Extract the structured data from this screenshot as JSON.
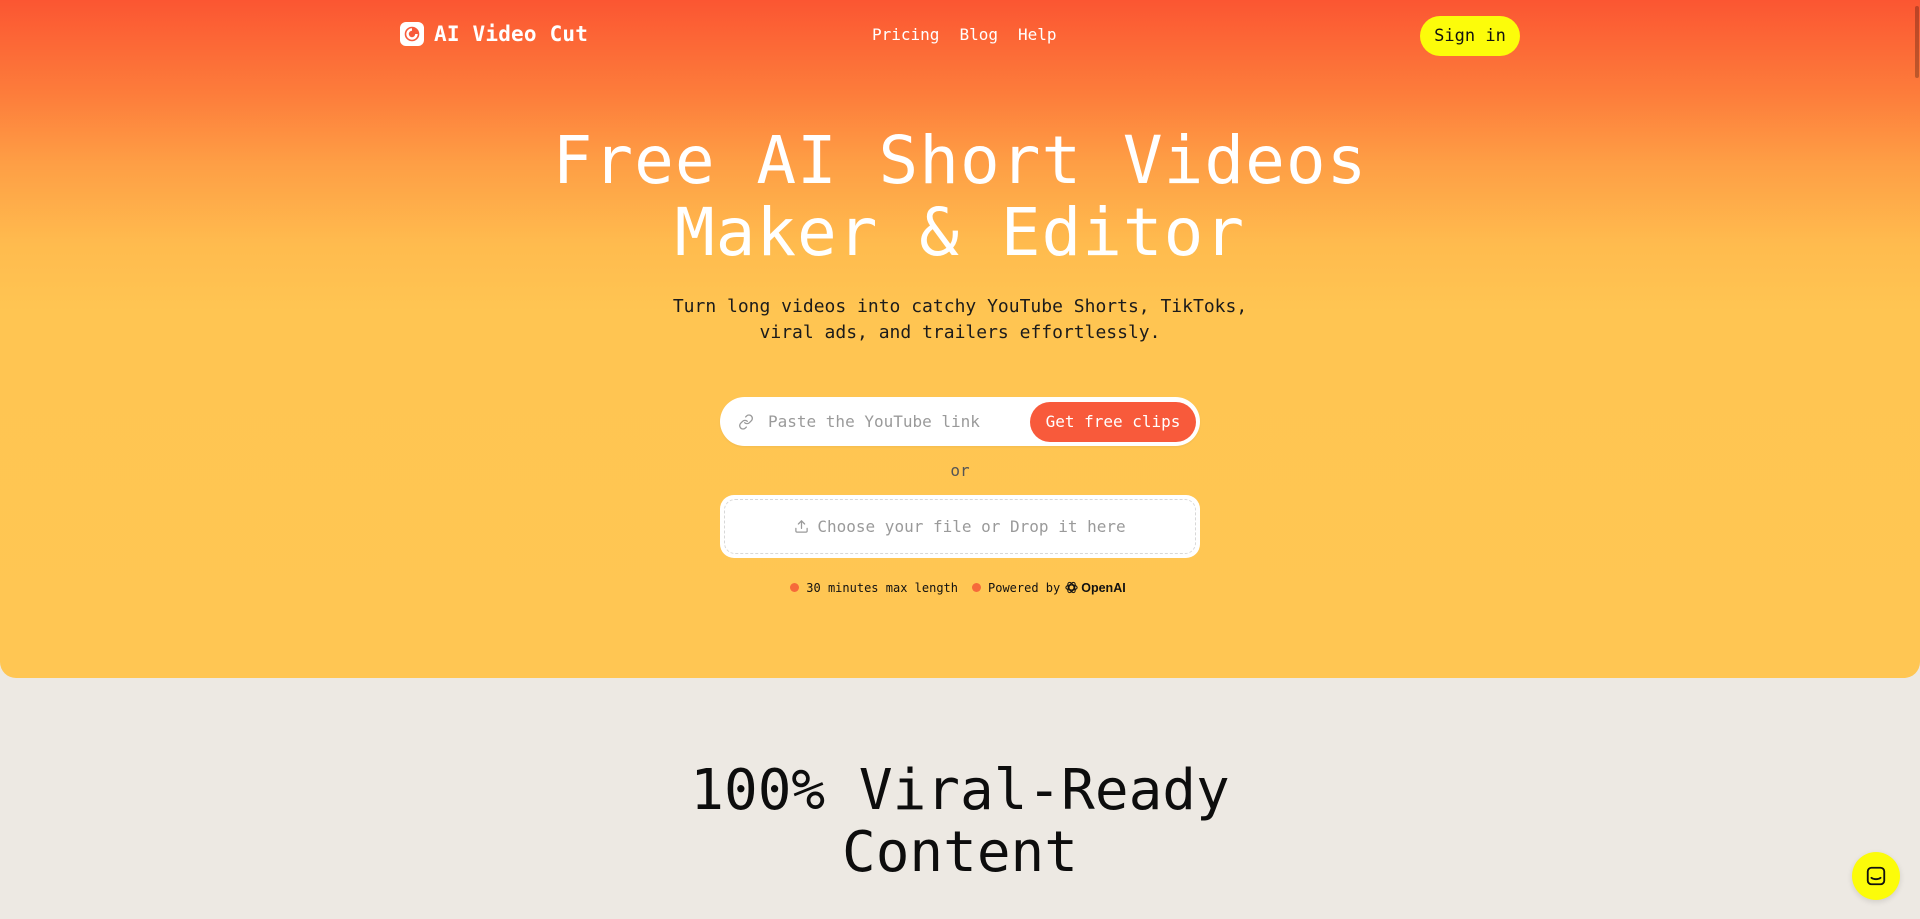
{
  "nav": {
    "brand": "AI Video Cut",
    "links": [
      {
        "label": "Pricing"
      },
      {
        "label": "Blog"
      },
      {
        "label": "Help"
      }
    ],
    "signin_label": "Sign in"
  },
  "hero": {
    "headline_line1": "Free AI Short Videos",
    "headline_line2": "Maker & Editor",
    "subhead_line1": "Turn long videos into catchy YouTube Shorts, TikToks,",
    "subhead_line2": "viral ads, and trailers effortlessly.",
    "url_placeholder": "Paste the YouTube link",
    "cta_label": "Get free clips",
    "or_text": "or",
    "upload_label": "Choose your file or Drop it here",
    "meta_length": "30 minutes max length",
    "meta_powered": "Powered by",
    "meta_openai": "OpenAI"
  },
  "section": {
    "title_line1": "100% Viral-Ready",
    "title_line2": "Content"
  },
  "colors": {
    "gradient_top": "#fb5632",
    "gradient_bottom": "#ffc653",
    "accent": "#f85a3b",
    "signin_bg": "#fcfc0a",
    "section_bg": "#ede9e3"
  },
  "icons": {
    "logo": "logo-icon",
    "link": "link-icon",
    "upload": "upload-icon",
    "openai": "openai-icon",
    "chat": "chat-icon"
  }
}
